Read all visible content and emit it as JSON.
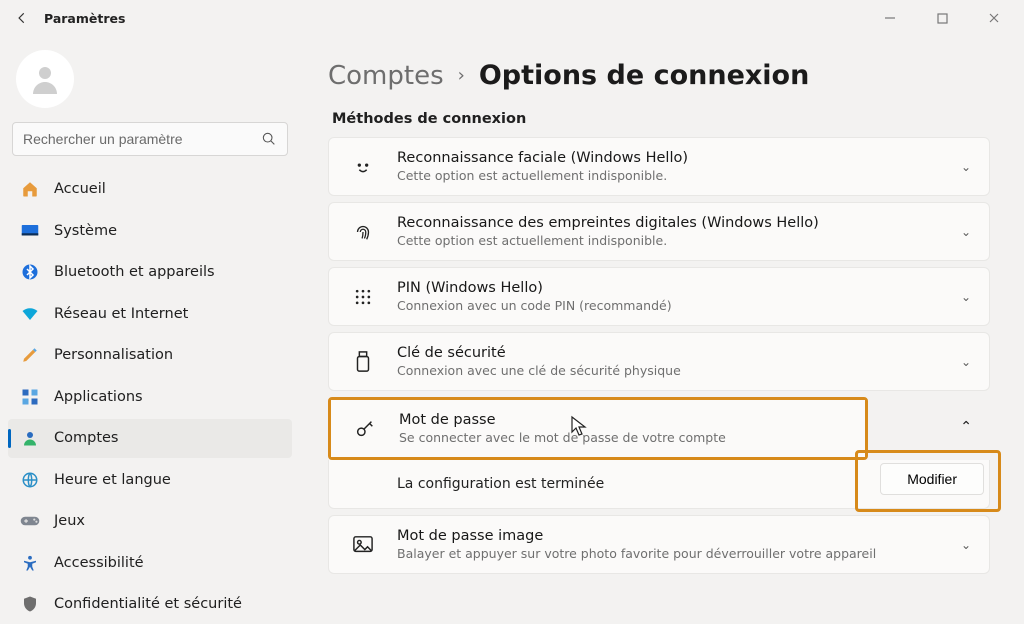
{
  "window": {
    "title": "Paramètres"
  },
  "search": {
    "placeholder": "Rechercher un paramètre"
  },
  "sidebar": {
    "items": [
      {
        "label": "Accueil"
      },
      {
        "label": "Système"
      },
      {
        "label": "Bluetooth et appareils"
      },
      {
        "label": "Réseau et Internet"
      },
      {
        "label": "Personnalisation"
      },
      {
        "label": "Applications"
      },
      {
        "label": "Comptes"
      },
      {
        "label": "Heure et langue"
      },
      {
        "label": "Jeux"
      },
      {
        "label": "Accessibilité"
      },
      {
        "label": "Confidentialité et sécurité"
      }
    ]
  },
  "breadcrumb": {
    "parent": "Comptes",
    "current": "Options de connexion"
  },
  "section": {
    "title": "Méthodes de connexion"
  },
  "methods": {
    "face": {
      "title": "Reconnaissance faciale (Windows Hello)",
      "desc": "Cette option est actuellement indisponible."
    },
    "finger": {
      "title": "Reconnaissance des empreintes digitales (Windows Hello)",
      "desc": "Cette option est actuellement indisponible."
    },
    "pin": {
      "title": "PIN (Windows Hello)",
      "desc": "Connexion avec un code PIN (recommandé)"
    },
    "key": {
      "title": "Clé de sécurité",
      "desc": "Connexion avec une clé de sécurité physique"
    },
    "pwd": {
      "title": "Mot de passe",
      "desc": "Se connecter avec le mot de passe de votre compte",
      "status": "La configuration est terminée",
      "modify_label": "Modifier"
    },
    "picpwd": {
      "title": "Mot de passe image",
      "desc": "Balayer et appuyer sur votre photo favorite pour déverrouiller votre appareil"
    }
  }
}
